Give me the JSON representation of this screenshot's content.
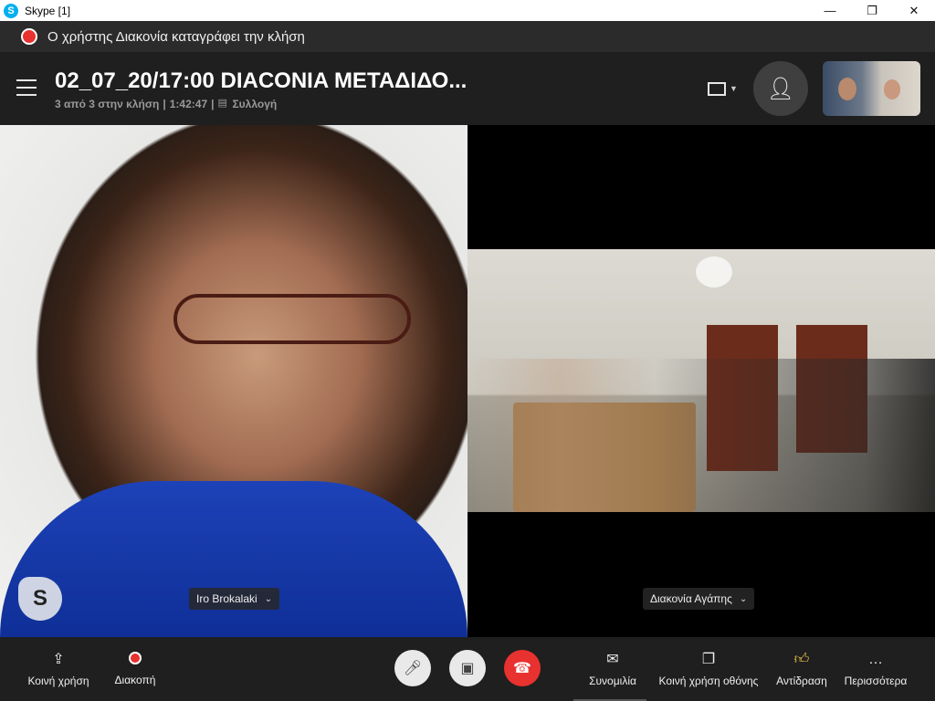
{
  "window": {
    "title": "Skype [1]",
    "app_icon": "S"
  },
  "recording": {
    "text": "Ο χρήστης Διακονία καταγράφει την κλήση"
  },
  "header": {
    "call_title": "02_07_20/17:00 DIACONIA ΜΕΤΑΔΙΔΟ...",
    "participants": "3 από 3 στην κλήση",
    "duration": "1:42:47",
    "gallery_label": "Συλλογή"
  },
  "videos": {
    "left": {
      "name": "Iro Brokalaki"
    },
    "right": {
      "name": "Διακονία Αγάπης"
    }
  },
  "toolbar": {
    "share_label": "Κοινή χρήση",
    "stop_label": "Διακοπή",
    "chat_label": "Συνομιλία",
    "screen_share_label": "Κοινή χρήση οθόνης",
    "reaction_label": "Αντίδραση",
    "more_label": "Περισσότερα"
  },
  "colors": {
    "record_red": "#e8322f",
    "background": "#1f1f1f",
    "skype_blue": "#00aff0",
    "reaction_yellow": "#f7c948"
  }
}
